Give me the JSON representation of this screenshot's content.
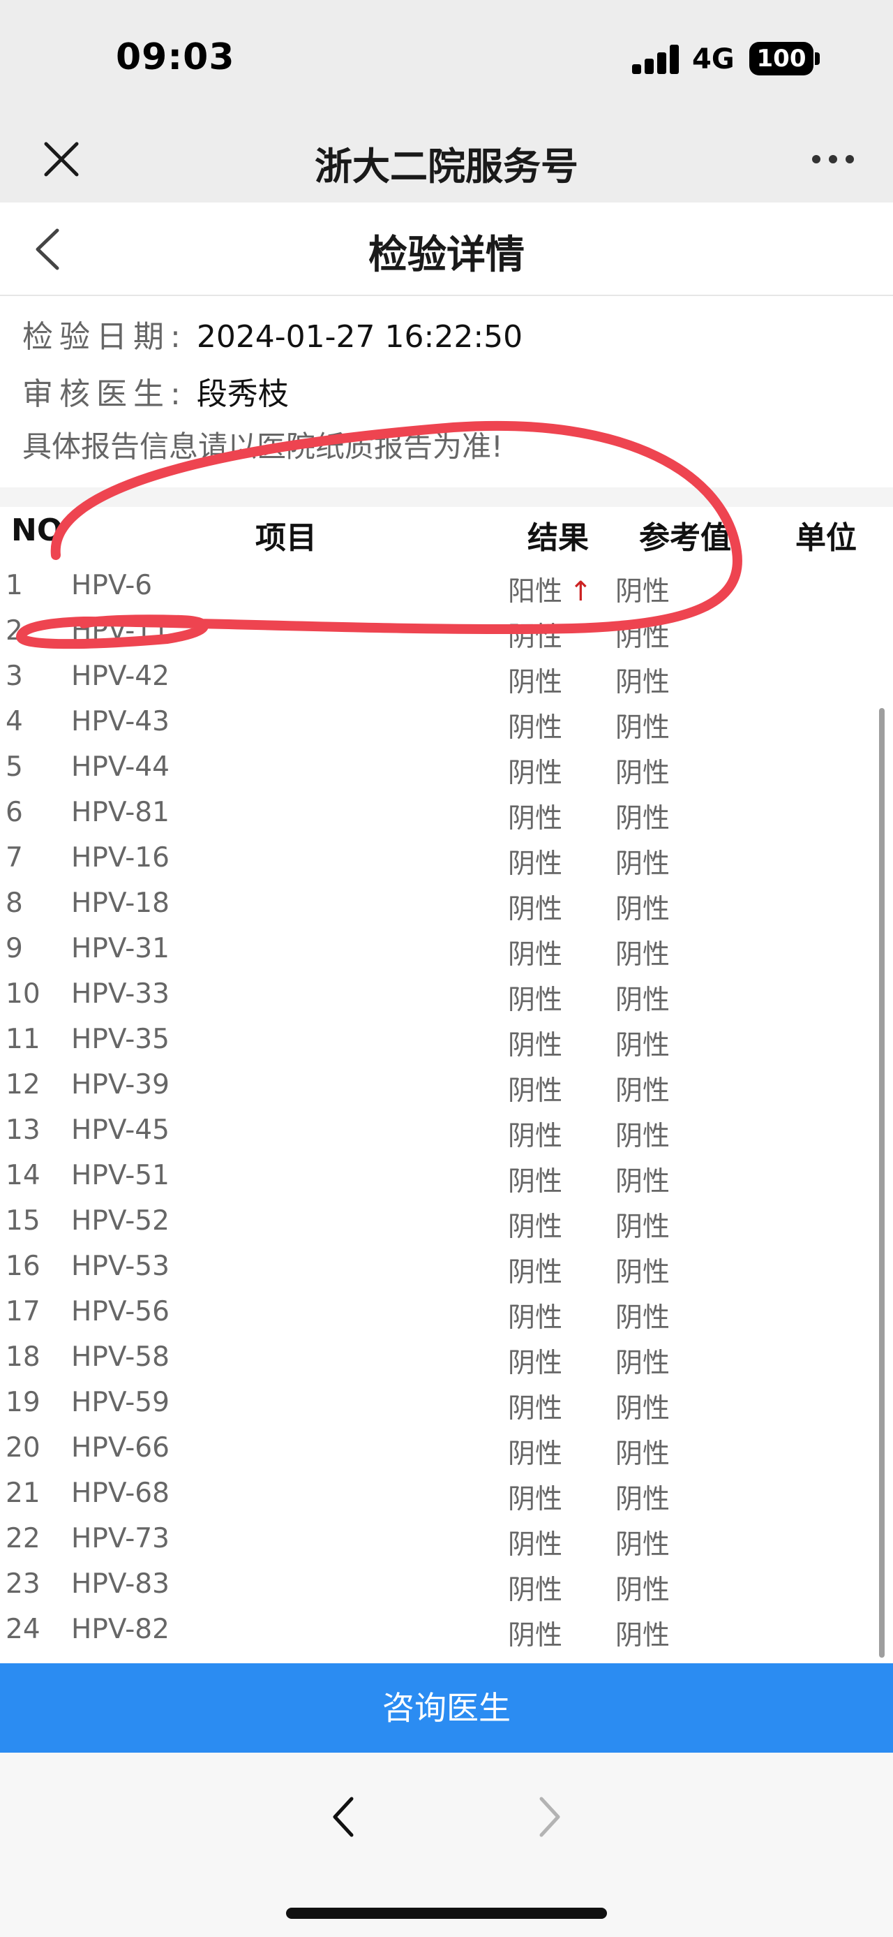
{
  "status_bar": {
    "time": "09:03",
    "network": "4G",
    "battery": "100",
    "signal_icon": "signal-bars-icon"
  },
  "wechat_header": {
    "title": "浙大二院服务号",
    "close_icon": "close-icon",
    "more_icon": "more-dots-icon"
  },
  "page_header": {
    "title": "检验详情",
    "back_icon": "chevron-left-icon"
  },
  "info": {
    "date_label": "检验日期:",
    "date_value": "2024-01-27 16:22:50",
    "doctor_label": "审核医生:",
    "doctor_value": "段秀枝",
    "note": "具体报告信息请以医院纸质报告为准!"
  },
  "table": {
    "headers": {
      "no": "NO",
      "item": "项目",
      "result": "结果",
      "reference": "参考值",
      "unit": "单位"
    },
    "rows": [
      {
        "no": "1",
        "item": "HPV-6",
        "result": "阳性",
        "flag": "↑",
        "reference": "阴性"
      },
      {
        "no": "2",
        "item": "HPV-11",
        "result": "阴性",
        "reference": "阴性"
      },
      {
        "no": "3",
        "item": "HPV-42",
        "result": "阴性",
        "reference": "阴性"
      },
      {
        "no": "4",
        "item": "HPV-43",
        "result": "阴性",
        "reference": "阴性"
      },
      {
        "no": "5",
        "item": "HPV-44",
        "result": "阴性",
        "reference": "阴性"
      },
      {
        "no": "6",
        "item": "HPV-81",
        "result": "阴性",
        "reference": "阴性"
      },
      {
        "no": "7",
        "item": "HPV-16",
        "result": "阴性",
        "reference": "阴性"
      },
      {
        "no": "8",
        "item": "HPV-18",
        "result": "阴性",
        "reference": "阴性"
      },
      {
        "no": "9",
        "item": "HPV-31",
        "result": "阴性",
        "reference": "阴性"
      },
      {
        "no": "10",
        "item": "HPV-33",
        "result": "阴性",
        "reference": "阴性"
      },
      {
        "no": "11",
        "item": "HPV-35",
        "result": "阴性",
        "reference": "阴性"
      },
      {
        "no": "12",
        "item": "HPV-39",
        "result": "阴性",
        "reference": "阴性"
      },
      {
        "no": "13",
        "item": "HPV-45",
        "result": "阴性",
        "reference": "阴性"
      },
      {
        "no": "14",
        "item": "HPV-51",
        "result": "阴性",
        "reference": "阴性"
      },
      {
        "no": "15",
        "item": "HPV-52",
        "result": "阴性",
        "reference": "阴性"
      },
      {
        "no": "16",
        "item": "HPV-53",
        "result": "阴性",
        "reference": "阴性"
      },
      {
        "no": "17",
        "item": "HPV-56",
        "result": "阴性",
        "reference": "阴性"
      },
      {
        "no": "18",
        "item": "HPV-58",
        "result": "阴性",
        "reference": "阴性"
      },
      {
        "no": "19",
        "item": "HPV-59",
        "result": "阴性",
        "reference": "阴性"
      },
      {
        "no": "20",
        "item": "HPV-66",
        "result": "阴性",
        "reference": "阴性"
      },
      {
        "no": "21",
        "item": "HPV-68",
        "result": "阴性",
        "reference": "阴性"
      },
      {
        "no": "22",
        "item": "HPV-73",
        "result": "阴性",
        "reference": "阴性"
      },
      {
        "no": "23",
        "item": "HPV-83",
        "result": "阴性",
        "reference": "阴性"
      },
      {
        "no": "24",
        "item": "HPV-82",
        "result": "阴性",
        "reference": "阴性"
      }
    ]
  },
  "consult_button": {
    "label": "咨询医生"
  },
  "bottom_bar": {
    "back_icon": "chevron-left-icon",
    "forward_icon": "chevron-right-icon"
  },
  "colors": {
    "accent": "#2b8cf2",
    "positive_flag": "#cc2222",
    "annotation_stroke": "#ee4450",
    "chrome_bg": "#ededed"
  }
}
